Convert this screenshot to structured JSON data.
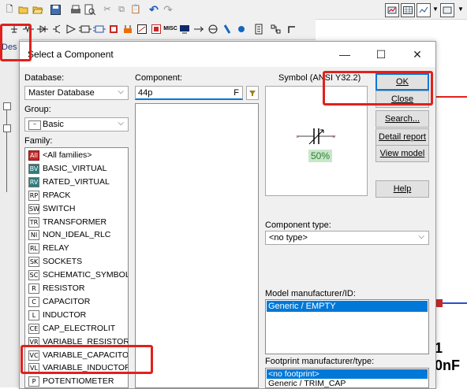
{
  "toolbar_top": {
    "icons": [
      "new-icon",
      "open-icon",
      "open-folder-icon",
      "save-icon",
      "print-icon",
      "print-preview-icon",
      "cut-icon",
      "copy-icon",
      "paste-icon",
      "undo-icon",
      "redo-icon"
    ],
    "right_icons": [
      "grapher-icon",
      "spreadsheet-icon",
      "postprocessor-icon",
      "more-icon",
      "dropdown-arrow-icon"
    ]
  },
  "toolbar_components": {
    "icons": [
      "place-source-icon",
      "place-basic-icon",
      "place-diode-icon",
      "place-transistor-icon",
      "place-analog-icon",
      "place-ttl-icon",
      "place-cmos-icon",
      "place-mcu-icon",
      "place-advanced-peripherals-icon",
      "place-mixed-icon",
      "place-indicator-icon",
      "place-power-icon",
      "place-misc-icon",
      "place-rf-icon",
      "place-electromechanical-icon",
      "place-ni-components-icon",
      "place-connectors-icon",
      "place-mcu2-icon",
      "place-hierarchical-icon",
      "place-bus-icon"
    ],
    "misc_label": "MISC"
  },
  "left_tab": "Des",
  "dialog": {
    "title": "Select a Component",
    "database_label": "Database:",
    "database_value": "Master Database",
    "group_label": "Group:",
    "group_value": "Basic",
    "family_label": "Family:",
    "families": [
      {
        "icon": "All",
        "label": "<All families>"
      },
      {
        "icon": "BV",
        "label": "BASIC_VIRTUAL"
      },
      {
        "icon": "RV",
        "label": "RATED_VIRTUAL"
      },
      {
        "icon": "RP",
        "label": "RPACK"
      },
      {
        "icon": "SW",
        "label": "SWITCH"
      },
      {
        "icon": "TR",
        "label": "TRANSFORMER"
      },
      {
        "icon": "NI",
        "label": "NON_IDEAL_RLC"
      },
      {
        "icon": "RL",
        "label": "RELAY"
      },
      {
        "icon": "SK",
        "label": "SOCKETS"
      },
      {
        "icon": "SC",
        "label": "SCHEMATIC_SYMBOLS"
      },
      {
        "icon": "R",
        "label": "RESISTOR"
      },
      {
        "icon": "C",
        "label": "CAPACITOR"
      },
      {
        "icon": "L",
        "label": "INDUCTOR"
      },
      {
        "icon": "CE",
        "label": "CAP_ELECTROLIT"
      },
      {
        "icon": "VR",
        "label": "VARIABLE_RESISTOR"
      },
      {
        "icon": "VC",
        "label": "VARIABLE_CAPACITOR"
      },
      {
        "icon": "VL",
        "label": "VARIABLE_INDUCTOR"
      },
      {
        "icon": "P",
        "label": "POTENTIOMETER"
      }
    ],
    "component_label": "Component:",
    "component_value": "44p",
    "filter_label": "F",
    "symbol_label": "Symbol (ANSI Y32.2)",
    "symbol_percent": "50%",
    "buttons": {
      "ok": "OK",
      "close": "Close",
      "search": "Search...",
      "detail_report": "Detail report",
      "view_model": "View model",
      "help": "Help"
    },
    "component_type_label": "Component type:",
    "component_type_value": "<no type>",
    "model_label": "Model manufacturer/ID:",
    "model_items": [
      "Generic / EMPTY"
    ],
    "footprint_label": "Footprint manufacturer/type:",
    "footprint_items": [
      "<no footprint>",
      "Generic / TRIM_CAP"
    ]
  },
  "canvas": {
    "label_1": "1",
    "label_2": "0nF"
  },
  "colors": {
    "highlight": "#e0211c",
    "selection": "#0078d7",
    "symbol_green": "#2e7d32"
  }
}
